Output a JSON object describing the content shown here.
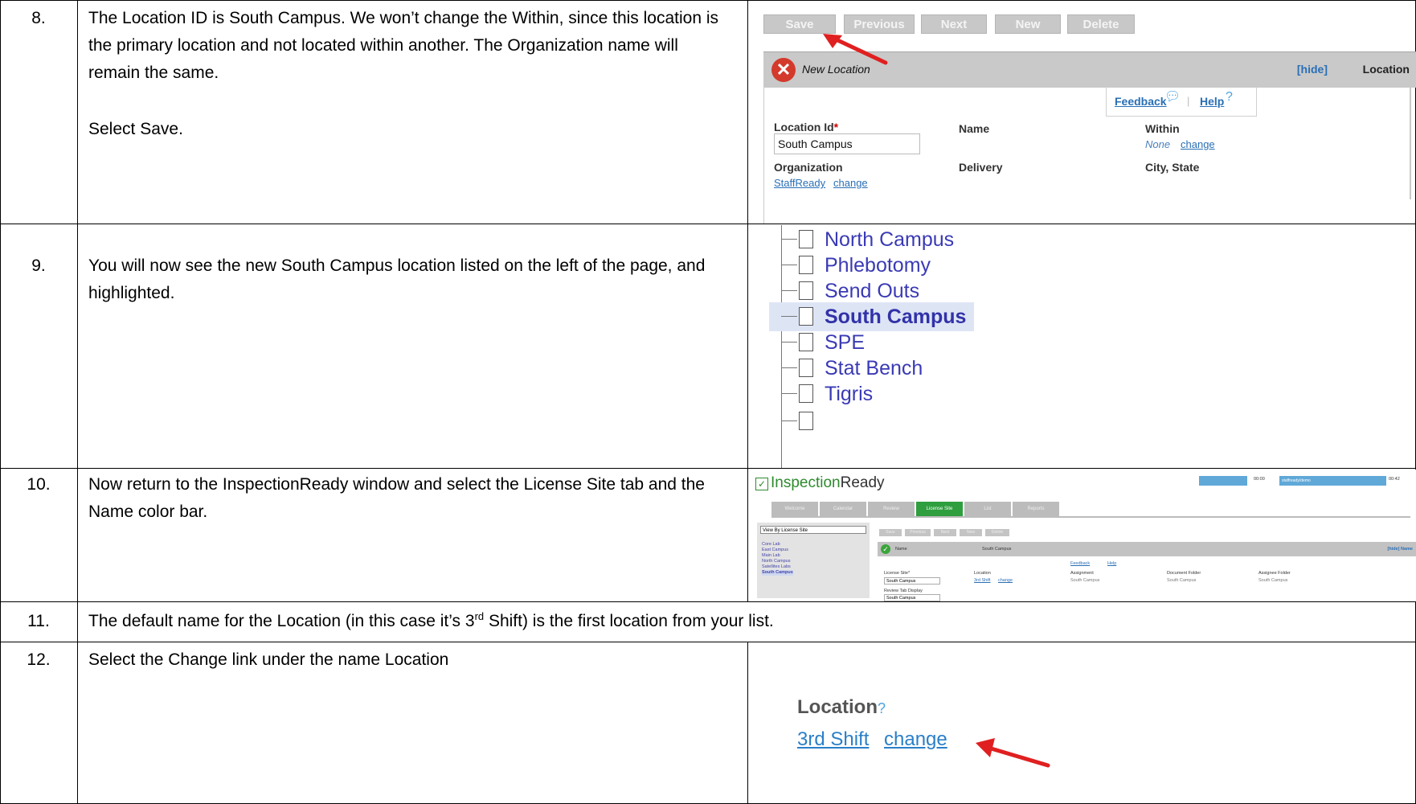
{
  "rows": [
    {
      "number": "8.",
      "paragraph1": "The Location ID is South Campus.  We won’t change the Within, since this location is the primary location and not located within another.  The Organization name will remain the same.",
      "paragraph2": "Select Save."
    },
    {
      "number": "9.",
      "paragraph1": "You will now see the new South Campus location listed on the left of the page, and highlighted."
    },
    {
      "number": "10.",
      "paragraph1": "Now return to the InspectionReady window and select the License Site tab and the Name color bar."
    },
    {
      "number": "11.",
      "text_before": "The default name for the Location (in this case it’s 3",
      "superscript": "rd",
      "text_after": " Shift) is the first location from your list."
    },
    {
      "number": "12.",
      "paragraph1": "Select the Change link under the name Location"
    }
  ],
  "form": {
    "toolbar": [
      "Save",
      "Previous",
      "Next",
      "New",
      "Delete"
    ],
    "header_title": "New Location",
    "hide_link": "[hide]",
    "header_right": "Location",
    "feedback": "Feedback",
    "help": "Help",
    "location_id_label": "Location Id",
    "required_mark": "*",
    "location_id_value": "South Campus",
    "name_label": "Name",
    "within_label": "Within",
    "within_value": "None",
    "within_change": "change",
    "organization_label": "Organization",
    "organization_value": "StaffReady",
    "organization_change": "change",
    "delivery_label": "Delivery",
    "city_state_label": "City, State"
  },
  "tree": {
    "items": [
      "North Campus",
      "Phlebotomy",
      "Send Outs",
      "South Campus",
      "SPE",
      "Stat Bench",
      "Tigris"
    ],
    "selected": "South Campus"
  },
  "inspection": {
    "logo_prefix": "Inspection",
    "logo_suffix": "Ready",
    "tabs": [
      "Welcome",
      "Calendar",
      "Review",
      "License Site",
      "List",
      "Reports"
    ],
    "active_tab": "License Site",
    "view_select": "View By License Site",
    "sites": [
      "Core Lab",
      "East Campus",
      "Main Lab",
      "North Campus",
      "Satellites Labs",
      "South Campus"
    ],
    "buttons": [
      "Save",
      "Previous",
      "Next",
      "New",
      "Delete"
    ],
    "header_label": "Name",
    "header_value": "South Campus",
    "header_right": "[hide] Name",
    "feedback": "Feedback",
    "help": "Help",
    "license_site_label": "License Site*",
    "license_site_value": "South Campus",
    "location_label": "Location",
    "location_value": "3rd Shift",
    "location_change": "change",
    "assignment_label": "Assignment",
    "assignment_value": "South Campus",
    "document_folder_label": "Document Folder",
    "document_folder_value": "South Campus",
    "assignee_folder_label": "Assignee Folder",
    "assignee_folder_value": "South Campus",
    "review_tab_label": "Review Tab Display",
    "review_tab_value": "South Campus",
    "top_user": "staffready/demo",
    "top_time": "00:42"
  },
  "location_change": {
    "label": "Location",
    "value": "3rd Shift",
    "change": "change"
  },
  "colors": {
    "link": "#2a6fb6",
    "arrow": "#e02020",
    "tree_text": "#3a3ab5",
    "highlight": "#dde5f5",
    "active_tab": "#2e9e3e"
  }
}
